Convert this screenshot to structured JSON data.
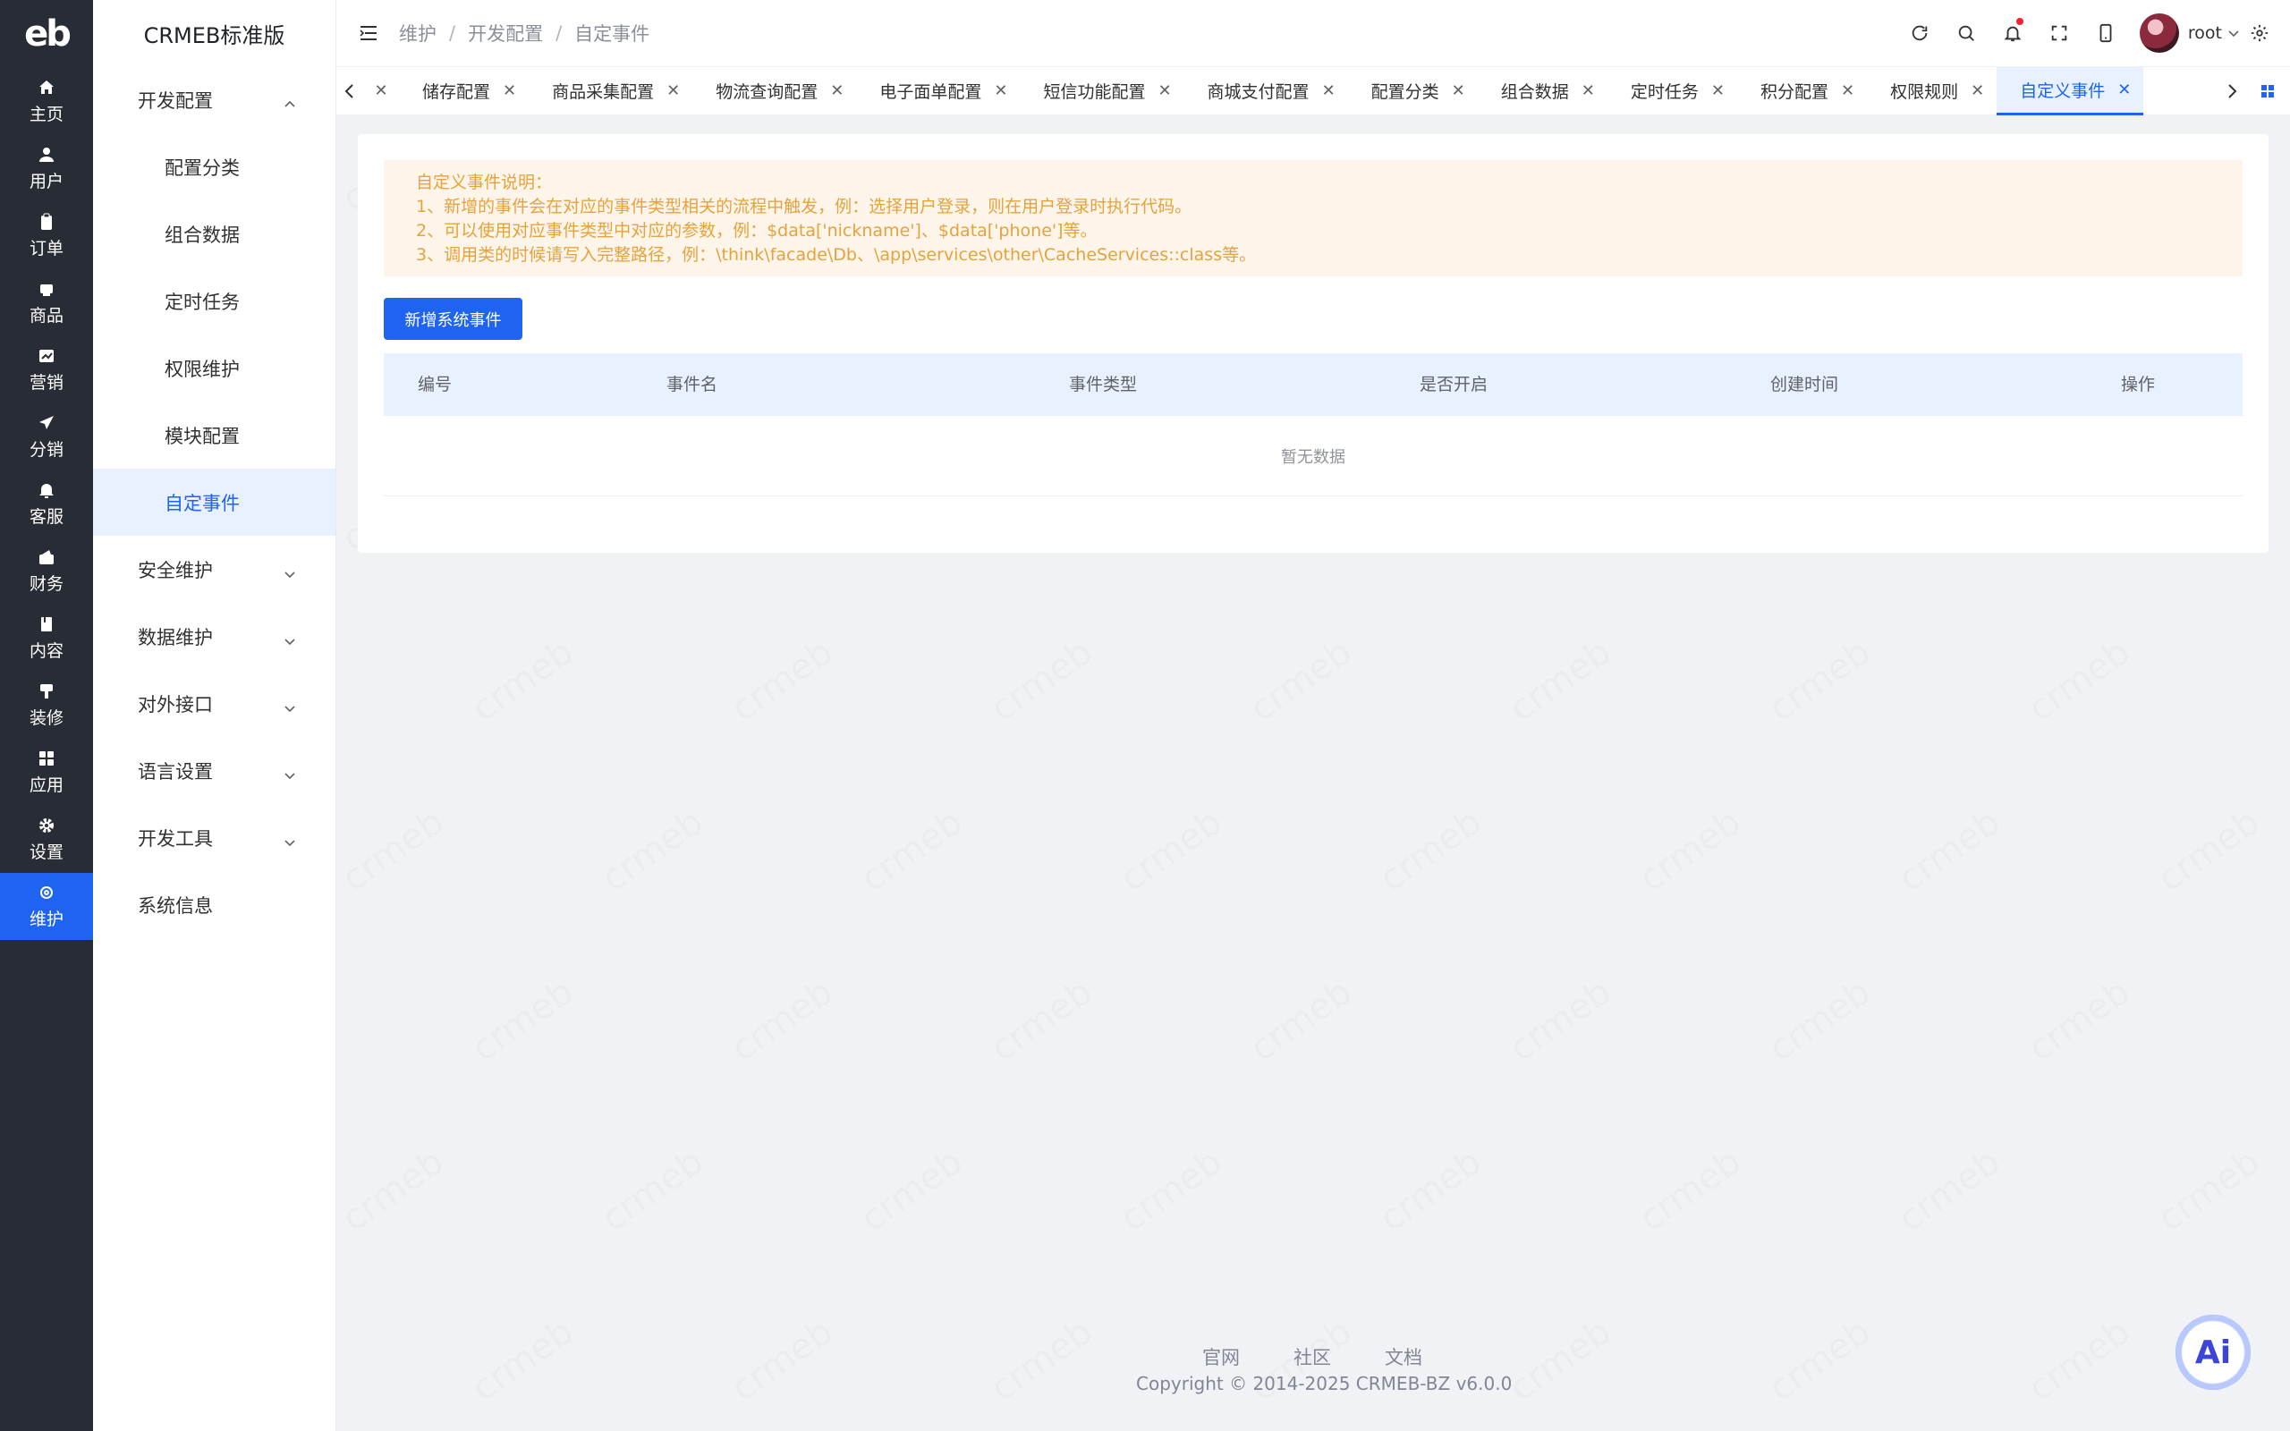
{
  "rail": {
    "logo": "eb",
    "items": [
      {
        "label": "主页",
        "icon": "home-icon"
      },
      {
        "label": "用户",
        "icon": "user-icon"
      },
      {
        "label": "订单",
        "icon": "clipboard-icon"
      },
      {
        "label": "商品",
        "icon": "shopping-bag-icon"
      },
      {
        "label": "营销",
        "icon": "chart-icon"
      },
      {
        "label": "分销",
        "icon": "send-icon"
      },
      {
        "label": "客服",
        "icon": "bell-icon"
      },
      {
        "label": "财务",
        "icon": "wallet-icon"
      },
      {
        "label": "内容",
        "icon": "book-icon"
      },
      {
        "label": "装修",
        "icon": "brush-icon"
      },
      {
        "label": "应用",
        "icon": "grid-icon"
      },
      {
        "label": "设置",
        "icon": "gear-icon"
      },
      {
        "label": "维护",
        "icon": "chip-icon",
        "active": true
      }
    ]
  },
  "subnav": {
    "title": "CRMEB标准版",
    "groups": [
      {
        "label": "开发配置",
        "expanded": true,
        "children": [
          {
            "label": "配置分类"
          },
          {
            "label": "组合数据"
          },
          {
            "label": "定时任务"
          },
          {
            "label": "权限维护"
          },
          {
            "label": "模块配置"
          },
          {
            "label": "自定事件",
            "active": true
          }
        ]
      },
      {
        "label": "安全维护"
      },
      {
        "label": "数据维护"
      },
      {
        "label": "对外接口"
      },
      {
        "label": "语言设置"
      },
      {
        "label": "开发工具"
      },
      {
        "label": "系统信息"
      }
    ]
  },
  "header": {
    "breadcrumb": [
      "维护",
      "开发配置",
      "自定事件"
    ],
    "separator": "/",
    "user": "root"
  },
  "tabs": [
    {
      "label": "储存配置"
    },
    {
      "label": "商品采集配置"
    },
    {
      "label": "物流查询配置"
    },
    {
      "label": "电子面单配置"
    },
    {
      "label": "短信功能配置"
    },
    {
      "label": "商城支付配置"
    },
    {
      "label": "配置分类"
    },
    {
      "label": "组合数据"
    },
    {
      "label": "定时任务"
    },
    {
      "label": "积分配置"
    },
    {
      "label": "权限规则"
    },
    {
      "label": "自定义事件",
      "active": true
    }
  ],
  "notice": {
    "title": "自定义事件说明：",
    "lines": [
      "1、新增的事件会在对应的事件类型相关的流程中触发，例：选择用户登录，则在用户登录时执行代码。",
      "2、可以使用对应事件类型中对应的参数，例：$data['nickname']、$data['phone']等。",
      "3、调用类的时候请写入完整路径，例：\\think\\facade\\Db、\\app\\services\\other\\CacheServices::class等。"
    ]
  },
  "add_button": "新增系统事件",
  "table": {
    "columns": [
      "编号",
      "事件名",
      "事件类型",
      "是否开启",
      "创建时间",
      "操作"
    ],
    "empty_text": "暂无数据"
  },
  "footer": {
    "links": [
      "官网",
      "社区",
      "文档"
    ],
    "copyright": "Copyright © 2014-2025 CRMEB-BZ v6.0.0"
  },
  "ai_button": "Ai",
  "watermark": "crmeb",
  "colors": {
    "primary": "#1e64f0",
    "rail_bg": "#282c34",
    "notice_bg": "#fdf5ea",
    "notice_text": "#e6a23c",
    "notification_dot": "#f5222d"
  }
}
